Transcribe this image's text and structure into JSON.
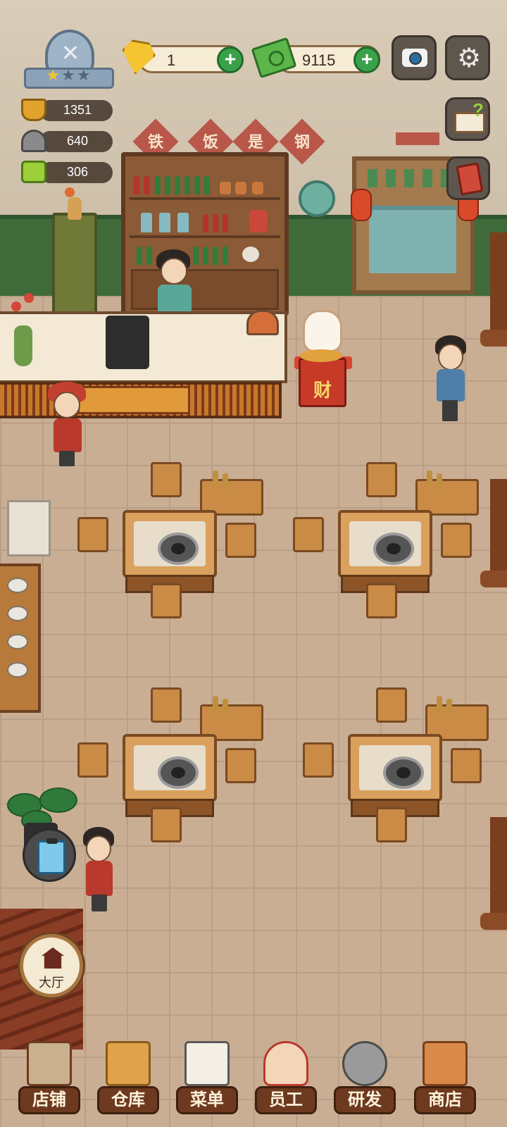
{
  "hud": {
    "gems": "1",
    "cash": "9115",
    "plus_label": "+",
    "stats": [
      {
        "name": "hotpot-icon",
        "value": "1351"
      },
      {
        "name": "dish-icon",
        "value": "640"
      },
      {
        "name": "recipe-card-icon",
        "value": "306"
      }
    ],
    "stars_filled": 1,
    "stars_total": 3
  },
  "decor": {
    "banner_chars": [
      "铁",
      "饭",
      "是",
      "钢"
    ],
    "fortune_char": "财"
  },
  "side": {
    "hall_label": "大厅"
  },
  "nav": {
    "items": [
      {
        "label": "店铺",
        "icon": "shop-building-icon"
      },
      {
        "label": "仓库",
        "icon": "warehouse-boxes-icon"
      },
      {
        "label": "菜单",
        "icon": "menu-clipboard-icon"
      },
      {
        "label": "员工",
        "icon": "staff-chef-icon"
      },
      {
        "label": "研发",
        "icon": "research-wok-icon"
      },
      {
        "label": "商店",
        "icon": "store-stall-icon"
      }
    ]
  },
  "colors": {
    "nav_label_bg": "#6e3a1f",
    "plus_button": "#3aa14a",
    "gold": "#f5c531"
  }
}
